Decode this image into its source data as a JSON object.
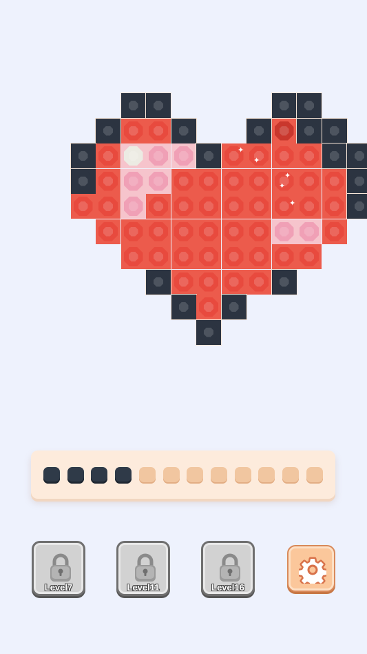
{
  "colors": {
    "dark_gem": "#2c3441",
    "red_gem": "#e84a3e",
    "pink_gem": "#f0a0b6",
    "white_gem": "#ecebe3",
    "red_cell": "#ec5b4c",
    "pink_cell": "#f6c4cc",
    "dark_cell": "#2c3441",
    "slot_filled": "#2f3a48",
    "slot_empty": "#f1c6a0"
  },
  "board": {
    "rows": [
      "...DD....DD...",
      "..DRRD..DrDD..",
      ".DRWPPDRRRRDD.",
      ".DRPPRRRRRRRD.",
      ".RRPRRRRRRRRD.",
      "..RRRRRRRPPR..",
      "...RRRRRRRR...",
      "....DRRRRD....",
      ".....DRD......",
      "......D......."
    ],
    "legend": {
      "D": "dark gem on dark tile",
      "R": "red gem on red tile",
      "r": "empty red tile",
      "P": "pink gem on pink tile",
      "W": "white gem on pink tile",
      "L": "red gem on light tile"
    }
  },
  "tray": {
    "total_slots": 12,
    "filled_slots": 4
  },
  "locked_levels": [
    {
      "label": "Level7"
    },
    {
      "label": "Level11"
    },
    {
      "label": "Level16"
    }
  ],
  "settings_icon": "gear-icon",
  "lock_icon": "padlock-icon"
}
